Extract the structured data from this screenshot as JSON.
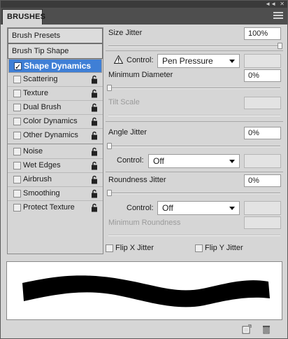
{
  "panel": {
    "tab_title": "BRUSHES"
  },
  "left": {
    "presets": [
      "Brush Presets",
      "Brush Tip Shape"
    ],
    "options": [
      {
        "label": "Shape Dynamics",
        "checked": true,
        "selected": true
      },
      {
        "label": "Scattering",
        "checked": false
      },
      {
        "label": "Texture",
        "checked": false
      },
      {
        "label": "Dual Brush",
        "checked": false
      },
      {
        "label": "Color Dynamics",
        "checked": false
      },
      {
        "label": "Other Dynamics",
        "checked": false
      },
      {
        "label": "Noise",
        "checked": false
      },
      {
        "label": "Wet Edges",
        "checked": false
      },
      {
        "label": "Airbrush",
        "checked": false
      },
      {
        "label": "Smoothing",
        "checked": false
      },
      {
        "label": "Protect Texture",
        "checked": false
      }
    ]
  },
  "size_jitter": {
    "label": "Size Jitter",
    "value": "100%",
    "control_label": "Control:",
    "control_value": "Pen Pressure"
  },
  "minimum_diameter": {
    "label": "Minimum Diameter",
    "value": "0%"
  },
  "tilt_scale": {
    "label": "Tilt Scale"
  },
  "angle_jitter": {
    "label": "Angle Jitter",
    "value": "0%",
    "control_label": "Control:",
    "control_value": "Off"
  },
  "roundness_jitter": {
    "label": "Roundness Jitter",
    "value": "0%",
    "control_label": "Control:",
    "control_value": "Off"
  },
  "minimum_roundness": {
    "label": "Minimum Roundness"
  },
  "flip": {
    "x_label": "Flip X Jitter",
    "y_label": "Flip Y Jitter"
  },
  "icons": {
    "warning": "warning-icon",
    "lock": "lock-icon",
    "new_brush": "new-brush-icon",
    "trash": "trash-icon"
  }
}
